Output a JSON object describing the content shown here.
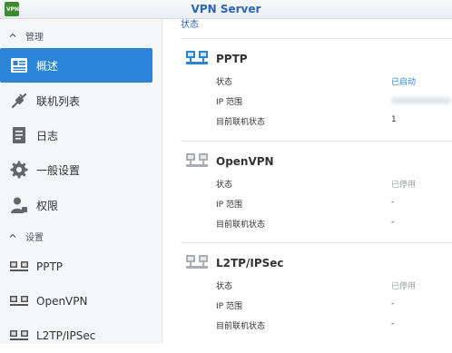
{
  "window": {
    "title": "VPN Server",
    "app_icon_text": "VPN"
  },
  "sidebar": {
    "group_manage": "管理",
    "group_settings": "设置",
    "manage_items": [
      {
        "label": "概述",
        "icon": "overview-icon",
        "active": true
      },
      {
        "label": "联机列表",
        "icon": "connection-list-icon"
      },
      {
        "label": "日志",
        "icon": "log-icon"
      },
      {
        "label": "一般设置",
        "icon": "gear-icon"
      },
      {
        "label": "权限",
        "icon": "user-permission-icon"
      }
    ],
    "settings_items": [
      {
        "label": "PPTP",
        "icon": "network-icon"
      },
      {
        "label": "OpenVPN",
        "icon": "network-icon"
      },
      {
        "label": "L2TP/IPSec",
        "icon": "network-icon"
      }
    ]
  },
  "main": {
    "top_label": "状态",
    "sections": [
      {
        "title": "PPTP",
        "rows": [
          {
            "label": "状态",
            "value": "已启动"
          },
          {
            "label": "IP 范围",
            "value": ""
          },
          {
            "label": "目前联机状态",
            "value": "1"
          }
        ]
      },
      {
        "title": "OpenVPN",
        "rows": [
          {
            "label": "状态",
            "value": "已停用"
          },
          {
            "label": "IP 范围",
            "value": "-"
          },
          {
            "label": "目前联机状态",
            "value": "-"
          }
        ]
      },
      {
        "title": "L2TP/IPSec",
        "rows": [
          {
            "label": "状态",
            "value": "已停用"
          },
          {
            "label": "IP 范围",
            "value": "-"
          },
          {
            "label": "目前联机状态",
            "value": "-"
          }
        ]
      }
    ]
  },
  "colors": {
    "accent": "#2a84d8",
    "title_blue": "#2b64b8",
    "status_active": "#2b84d8",
    "status_disabled": "#9aa0a6"
  }
}
